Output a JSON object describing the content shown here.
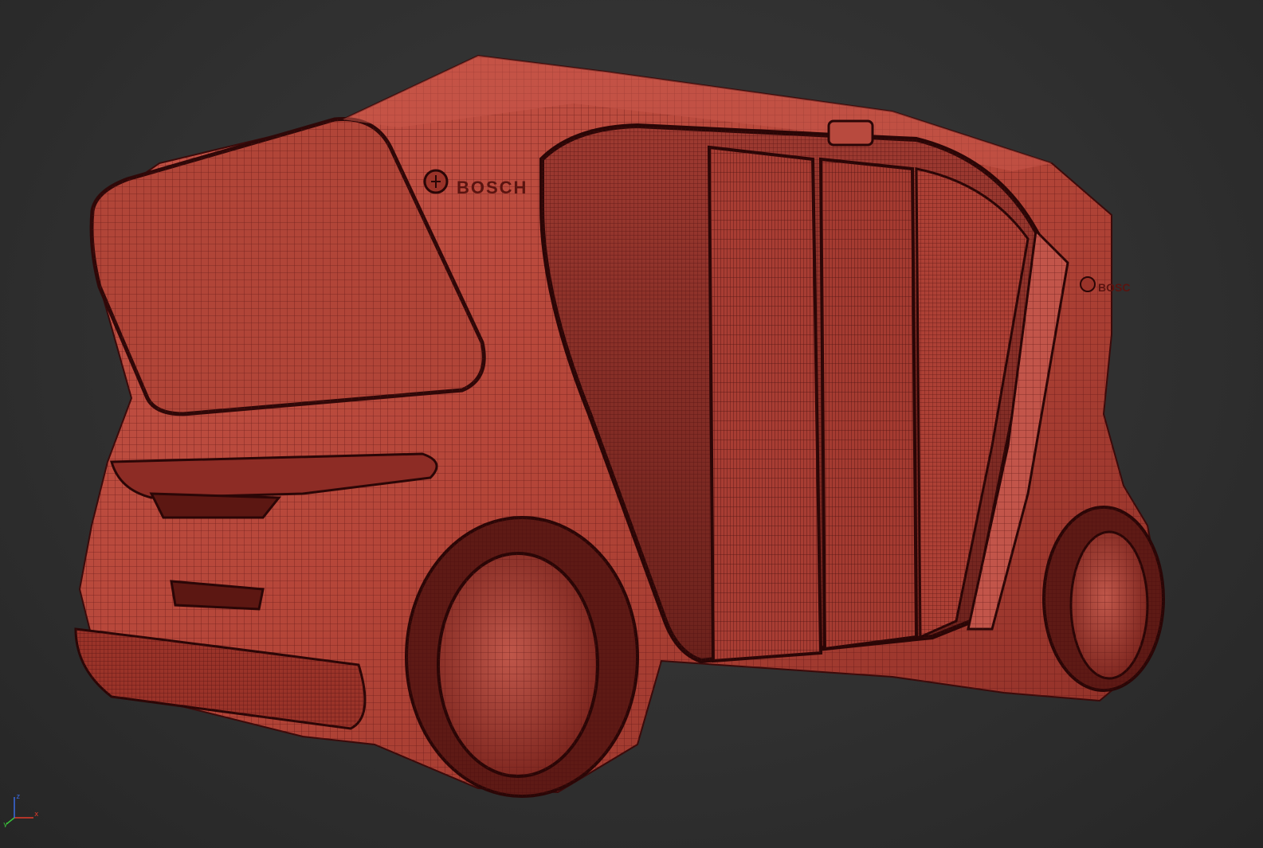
{
  "viewport": {
    "background": "#323232",
    "model": {
      "shading_color": "#b8493f",
      "wire_color": "#4a1010",
      "brand_text_front": "BOSCH",
      "brand_text_rear": "BOSC",
      "icons": [
        "bosch-logo-icon"
      ]
    },
    "gizmo": {
      "axes": [
        "x",
        "y",
        "z"
      ],
      "labels": {
        "x": "x",
        "y": "y",
        "z": "z"
      },
      "colors": {
        "x": "#e03a2a",
        "y": "#3ac03a",
        "z": "#3a6ae0"
      }
    }
  }
}
